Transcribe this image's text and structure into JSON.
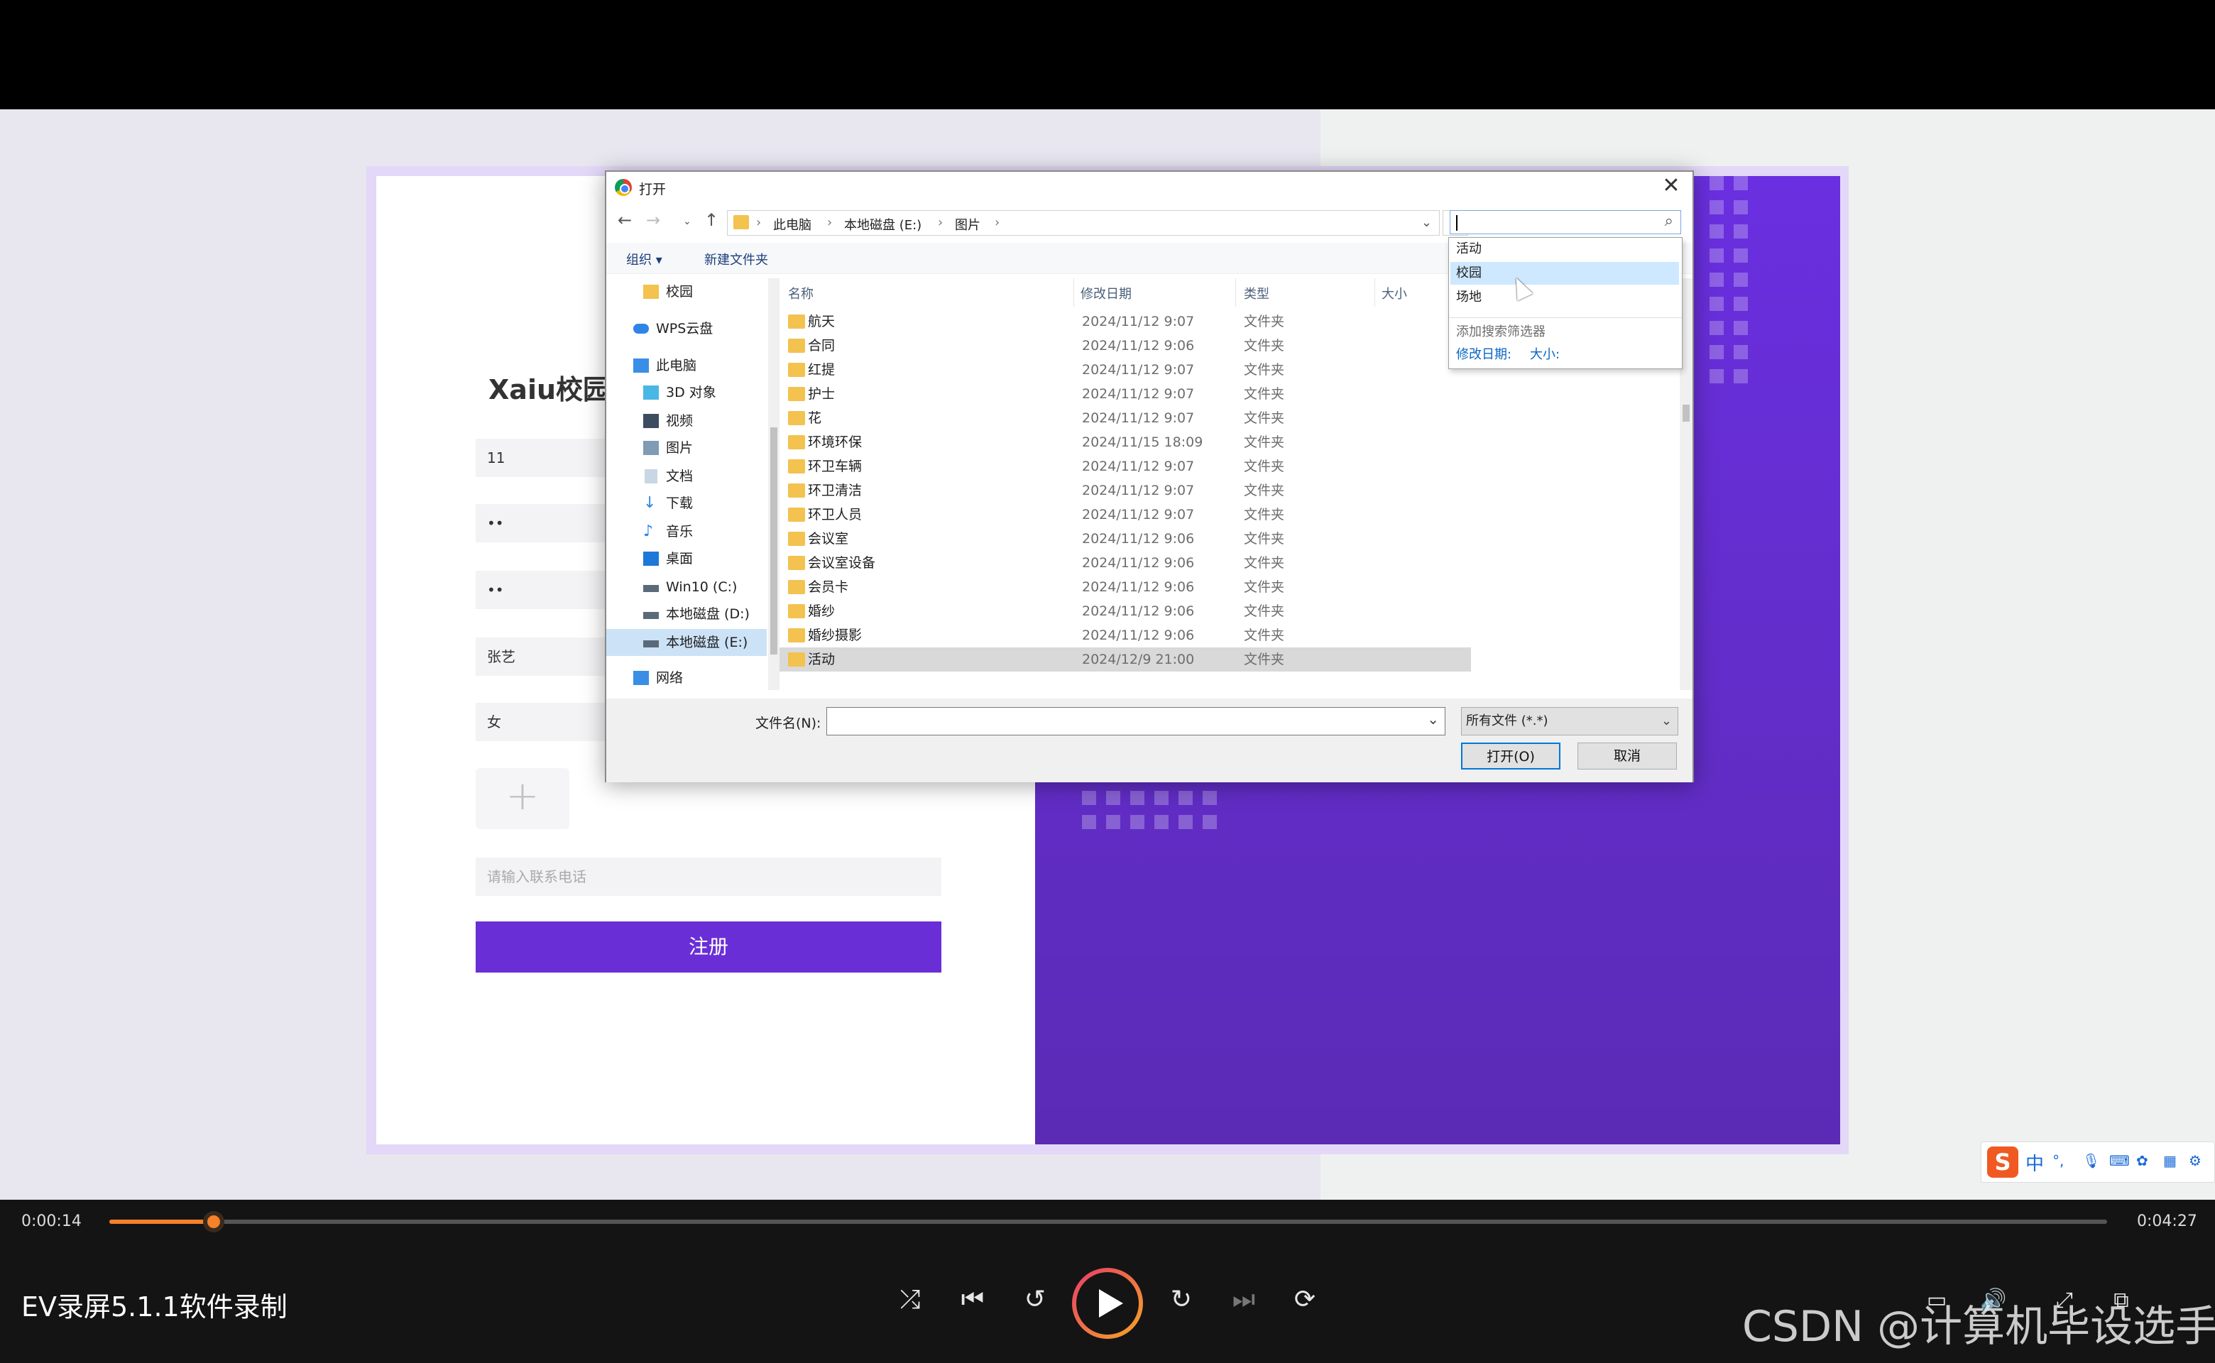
{
  "form": {
    "title": "Xaiu校园",
    "fields": [
      "11",
      "••",
      "••",
      "张艺",
      "女"
    ],
    "upload_plus": "+",
    "phone_placeholder": "请输入联系电话",
    "register_label": "注册"
  },
  "dialog": {
    "title": "打开",
    "close": "✕",
    "breadcrumb": [
      "此电脑",
      "本地磁盘 (E:)",
      "图片"
    ],
    "toolbar": {
      "organize": "组织 ▾",
      "new_folder": "新建文件夹"
    },
    "nav": [
      {
        "label": "校园",
        "icon": "folder-icon"
      },
      {
        "label": "WPS云盘",
        "icon": "cloud-icon"
      },
      {
        "label": "此电脑",
        "icon": "computer-icon"
      },
      {
        "label": "3D 对象",
        "icon": "cube-icon"
      },
      {
        "label": "视频",
        "icon": "video-icon"
      },
      {
        "label": "图片",
        "icon": "picture-icon"
      },
      {
        "label": "文档",
        "icon": "document-icon"
      },
      {
        "label": "下载",
        "icon": "download-icon"
      },
      {
        "label": "音乐",
        "icon": "music-icon"
      },
      {
        "label": "桌面",
        "icon": "desktop-icon"
      },
      {
        "label": "Win10 (C:)",
        "icon": "drive-icon"
      },
      {
        "label": "本地磁盘 (D:)",
        "icon": "drive-icon"
      },
      {
        "label": "本地磁盘 (E:)",
        "icon": "drive-icon",
        "selected": true
      },
      {
        "label": "网络",
        "icon": "network-icon"
      }
    ],
    "columns": {
      "name": "名称",
      "date": "修改日期",
      "type": "类型",
      "size": "大小"
    },
    "files": [
      {
        "name": "航天",
        "date": "2024/11/12 9:07",
        "type": "文件夹"
      },
      {
        "name": "合同",
        "date": "2024/11/12 9:06",
        "type": "文件夹"
      },
      {
        "name": "红提",
        "date": "2024/11/12 9:07",
        "type": "文件夹"
      },
      {
        "name": "护士",
        "date": "2024/11/12 9:07",
        "type": "文件夹"
      },
      {
        "name": "花",
        "date": "2024/11/12 9:07",
        "type": "文件夹"
      },
      {
        "name": "环境环保",
        "date": "2024/11/15 18:09",
        "type": "文件夹"
      },
      {
        "name": "环卫车辆",
        "date": "2024/11/12 9:07",
        "type": "文件夹"
      },
      {
        "name": "环卫清洁",
        "date": "2024/11/12 9:07",
        "type": "文件夹"
      },
      {
        "name": "环卫人员",
        "date": "2024/11/12 9:07",
        "type": "文件夹"
      },
      {
        "name": "会议室",
        "date": "2024/11/12 9:06",
        "type": "文件夹"
      },
      {
        "name": "会议室设备",
        "date": "2024/11/12 9:06",
        "type": "文件夹"
      },
      {
        "name": "会员卡",
        "date": "2024/11/12 9:06",
        "type": "文件夹"
      },
      {
        "name": "婚纱",
        "date": "2024/11/12 9:06",
        "type": "文件夹"
      },
      {
        "name": "婚纱摄影",
        "date": "2024/11/12 9:06",
        "type": "文件夹"
      },
      {
        "name": "活动",
        "date": "2024/12/9 21:00",
        "type": "文件夹",
        "selected": true
      }
    ],
    "filename_label": "文件名(N):",
    "filename_value": "",
    "filetype": "所有文件 (*.*)",
    "open_label": "打开(O)",
    "cancel_label": "取消",
    "search_suggestions": [
      "活动",
      "校园",
      "场地"
    ],
    "add_filter": "添加搜索筛选器",
    "filter_links": [
      "修改日期:",
      "大小:"
    ]
  },
  "ime": {
    "logo": "S",
    "mode": "中"
  },
  "player": {
    "current_time": "0:00:14",
    "total_time": "0:04:27",
    "progress": 0.0524,
    "title": "EV录屏5.1.1软件录制",
    "watermark": "CSDN @计算机毕设选手"
  },
  "colors": {
    "accent": "#6a2ed6",
    "progress": "#f5812a"
  }
}
